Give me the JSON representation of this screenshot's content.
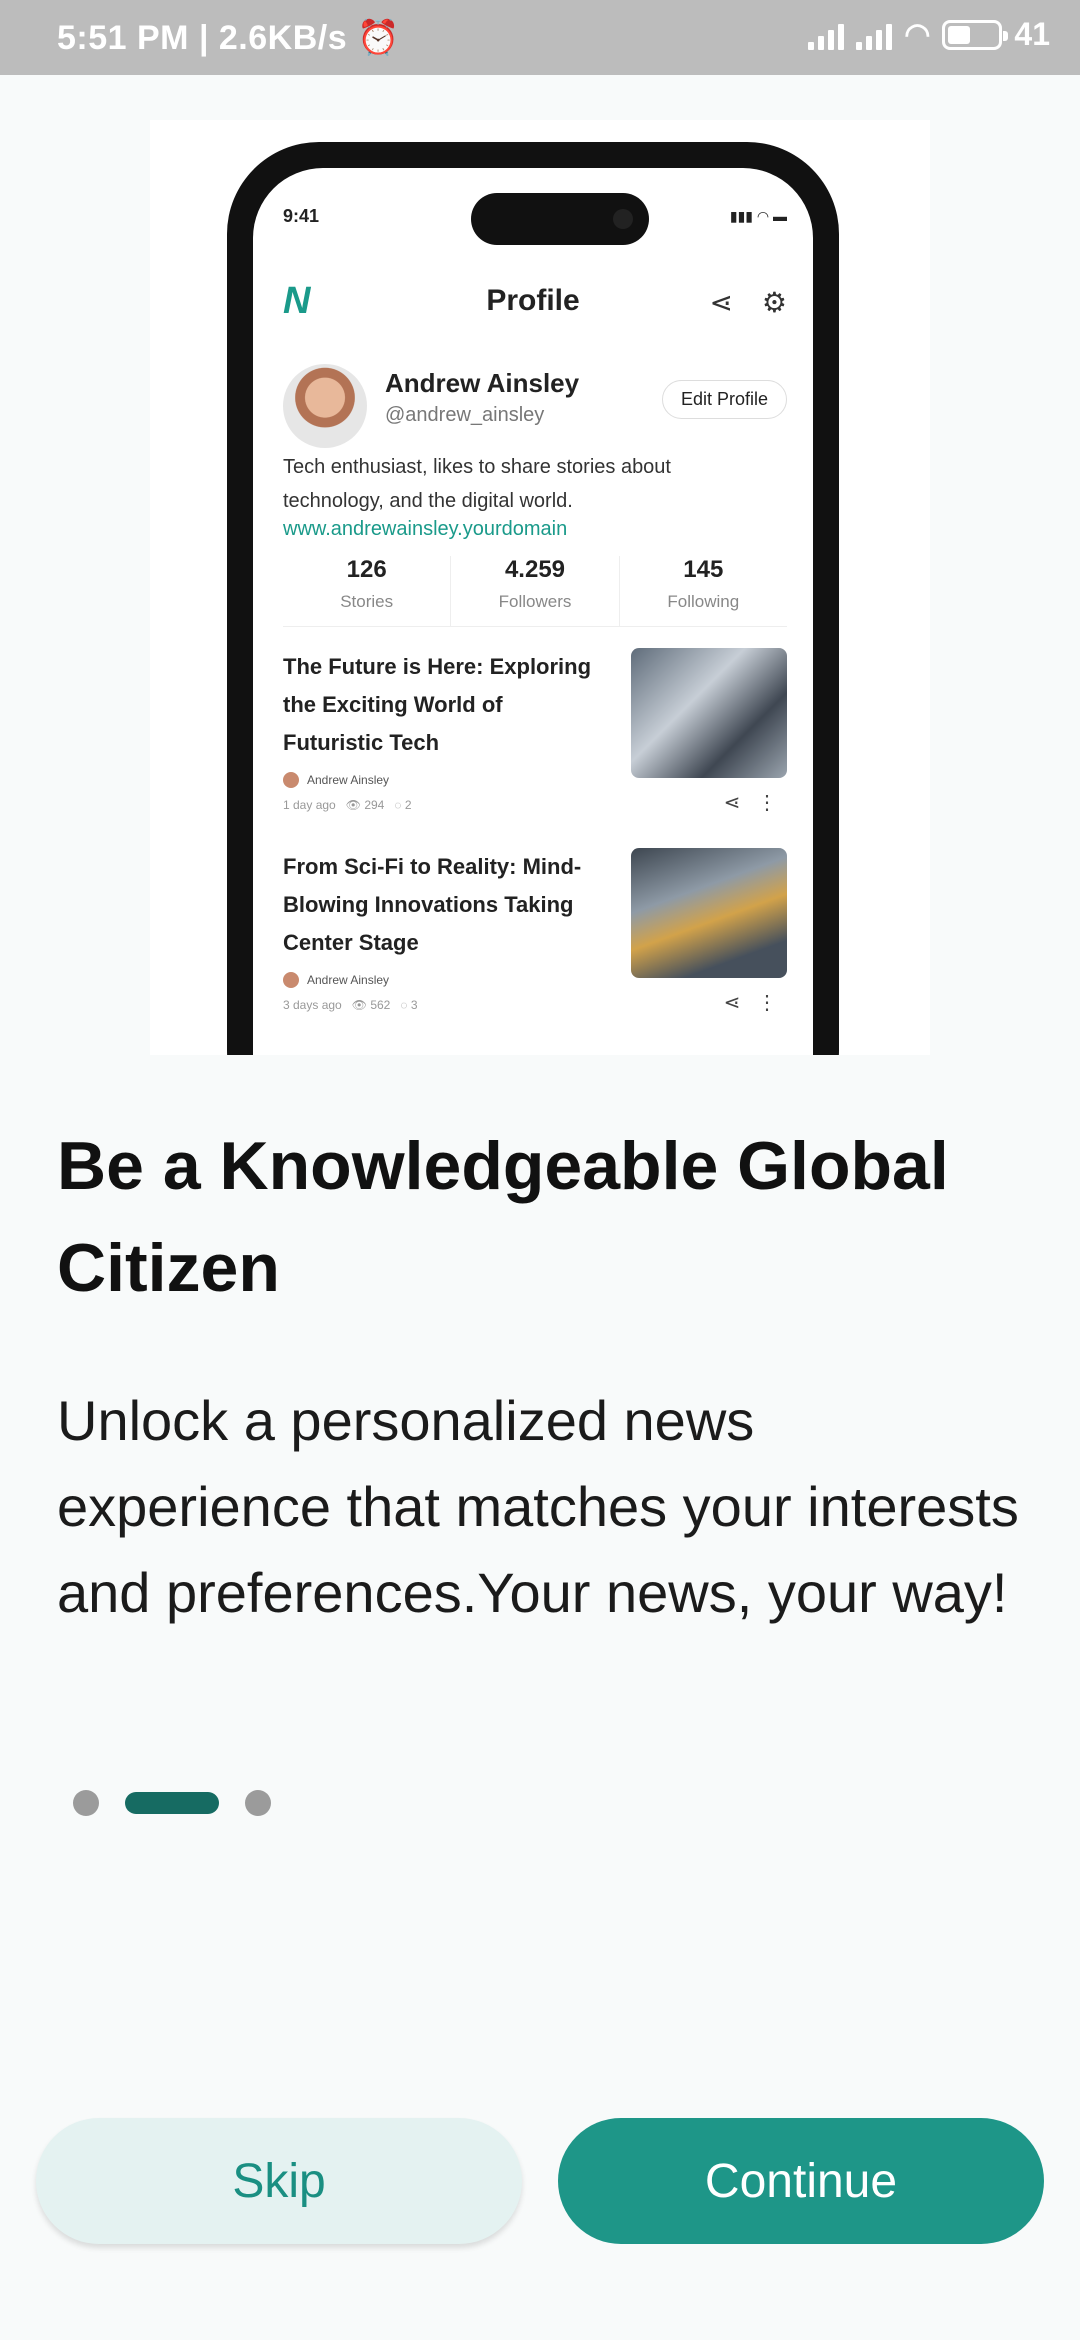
{
  "status_bar": {
    "time": "5:51 PM | 2.6KB/s",
    "battery": "41"
  },
  "mockup": {
    "time": "9:41",
    "header_title": "Profile",
    "profile_name": "Andrew Ainsley",
    "profile_handle": "@andrew_ainsley",
    "edit_button": "Edit Profile",
    "bio": "Tech enthusiast, likes to share stories about technology, and the digital world.",
    "link": "www.andrewainsley.yourdomain",
    "stats": [
      {
        "value": "126",
        "label": "Stories"
      },
      {
        "value": "4.259",
        "label": "Followers"
      },
      {
        "value": "145",
        "label": "Following"
      }
    ],
    "articles": [
      {
        "title": "The Future is Here: Exploring the Exciting World of Futuristic Tech",
        "author": "Andrew Ainsley",
        "time": "1 day ago",
        "views": "294",
        "comments": "2"
      },
      {
        "title": "From Sci-Fi to Reality: Mind-Blowing Innovations Taking Center Stage",
        "author": "Andrew Ainsley",
        "time": "3 days ago",
        "views": "562",
        "comments": "3"
      }
    ]
  },
  "onboarding": {
    "headline": "Be a Knowledgeable Global Citizen",
    "description": "Unlock a personalized news experience that matches your interests and preferences.Your news, your way!",
    "page_index": 2,
    "page_count": 3
  },
  "buttons": {
    "skip": "Skip",
    "continue": "Continue"
  },
  "colors": {
    "accent": "#1e9688",
    "skip_bg": "#e4f2f1",
    "active_dot": "#166b62"
  }
}
